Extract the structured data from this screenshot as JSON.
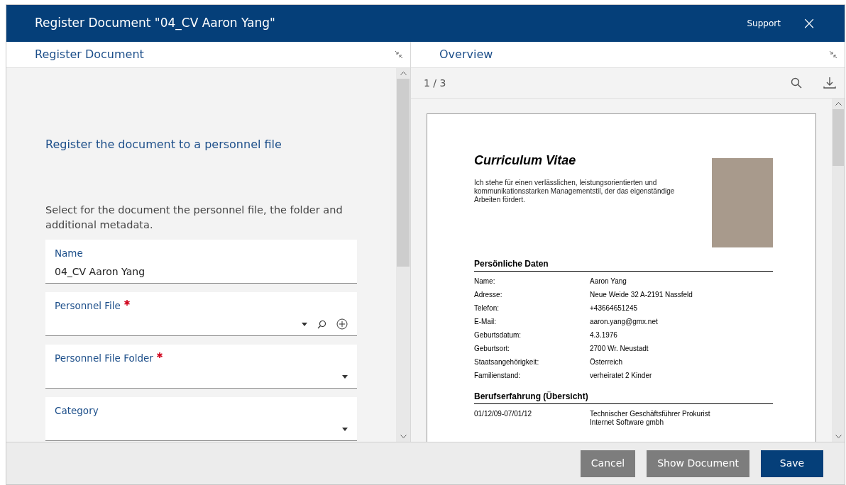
{
  "window": {
    "title": "Register Document \"04_CV Aaron Yang\"",
    "support_link": "Support",
    "close": "×"
  },
  "left_pane": {
    "title": "Register Document",
    "heading": "Register the document to a personnel file",
    "description": "Select for the document the personnel file, the folder and additional metadata.",
    "fields": [
      {
        "label": "Name",
        "value": "04_CV Aaron Yang",
        "required": false,
        "kind": "text"
      },
      {
        "label": "Personnel File",
        "required": true,
        "kind": "lookup"
      },
      {
        "label": "Personnel File Folder",
        "required": true,
        "kind": "dropdown"
      },
      {
        "label": "Category",
        "required": false,
        "kind": "dropdown"
      }
    ]
  },
  "right_pane": {
    "title": "Overview",
    "page_indicator": "1 / 3",
    "document": {
      "title": "Curriculum Vitae",
      "intro": "Ich stehe für einen verlässlichen, leistungsorientierten und kommunikationsstarken Managementstil, der das eigenständige Arbeiten fördert.",
      "sections": [
        {
          "heading": "Persönliche Daten",
          "rows": [
            {
              "label": "Name:",
              "value": "Aaron Yang"
            },
            {
              "label": "Adresse:",
              "value": "Neue Weide 32  A-2191 Nassfeld"
            },
            {
              "label": "Telefon:",
              "value": "+43664651245"
            },
            {
              "label": "E-Mail:",
              "value": "aaron.yang@gmx.net"
            },
            {
              "label": "Geburtsdatum:",
              "value": "4.3.1976"
            },
            {
              "label": "Geburtsort:",
              "value": "2700 Wr. Neustadt"
            },
            {
              "label": "Staatsangehörigkeit:",
              "value": "Österreich"
            },
            {
              "label": "Familienstand:",
              "value": "verheiratet 2 Kinder"
            }
          ]
        },
        {
          "heading": "Berufserfahrung (Übersicht)",
          "rows": [
            {
              "label": "01/12/09-07/01/12",
              "value": "Technischer Geschäftsführer Prokurist\nInternet Software gmbh"
            }
          ]
        }
      ]
    }
  },
  "buttons": [
    {
      "label": "Cancel",
      "kind": "secondary"
    },
    {
      "label": "Show Document",
      "kind": "secondary"
    },
    {
      "label": "Save",
      "kind": "primary"
    }
  ]
}
